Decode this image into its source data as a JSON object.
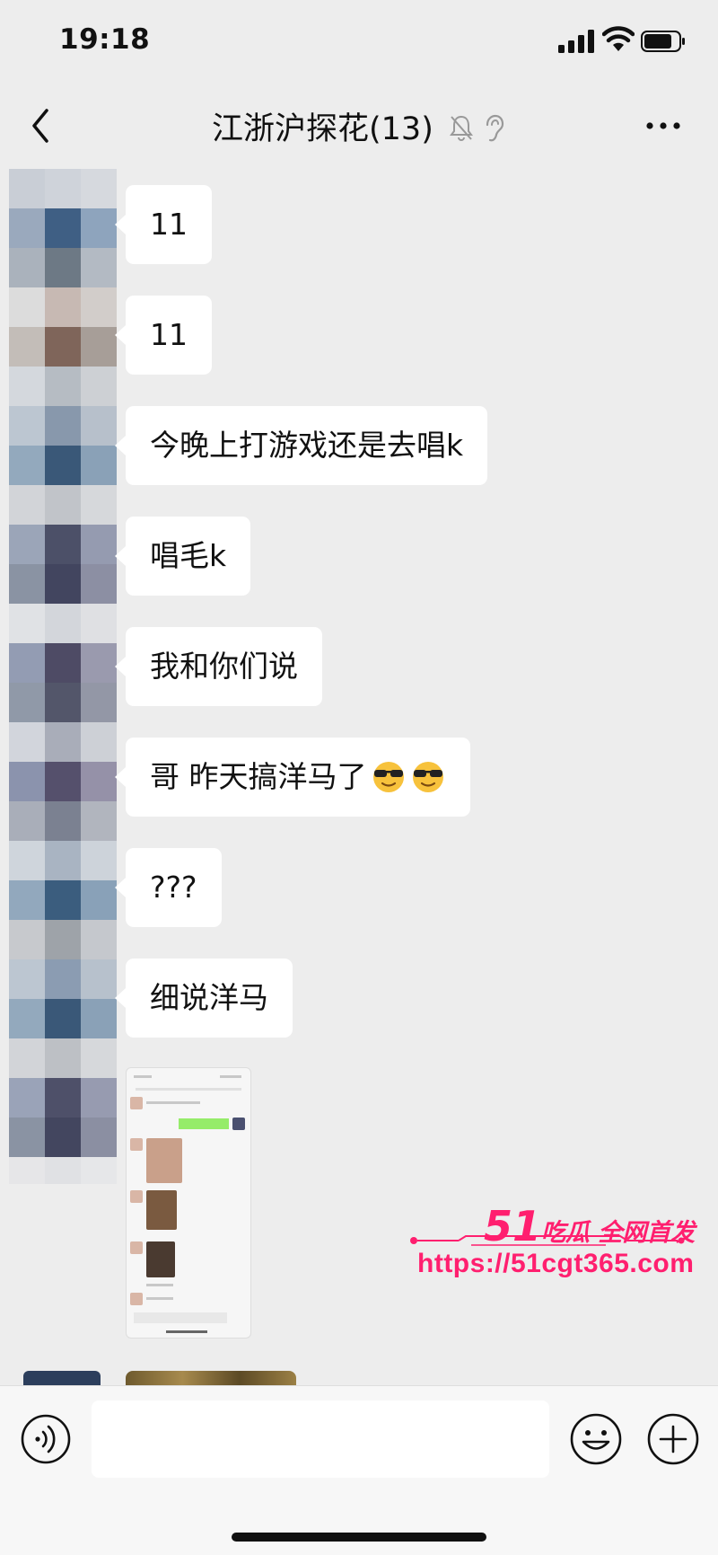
{
  "status_bar": {
    "time": "19:18"
  },
  "header": {
    "title": "江浙沪探花(13)"
  },
  "messages": [
    {
      "text": "11"
    },
    {
      "text": "11"
    },
    {
      "text": "今晚上打游戏还是去唱k"
    },
    {
      "text": "唱毛k"
    },
    {
      "text": "我和你们说"
    },
    {
      "text": "哥 昨天搞洋马了",
      "emoji": "cool-face-emoji"
    },
    {
      "text": "???"
    },
    {
      "text": "细说洋马"
    }
  ],
  "watermark": {
    "brand_number": "51",
    "brand_text": "吃瓜 全网首发",
    "url": "https://51cgt365.com"
  },
  "input": {
    "value": ""
  },
  "colors": {
    "background": "#ededed",
    "bubble": "#ffffff",
    "watermark": "#ff1f6f"
  }
}
